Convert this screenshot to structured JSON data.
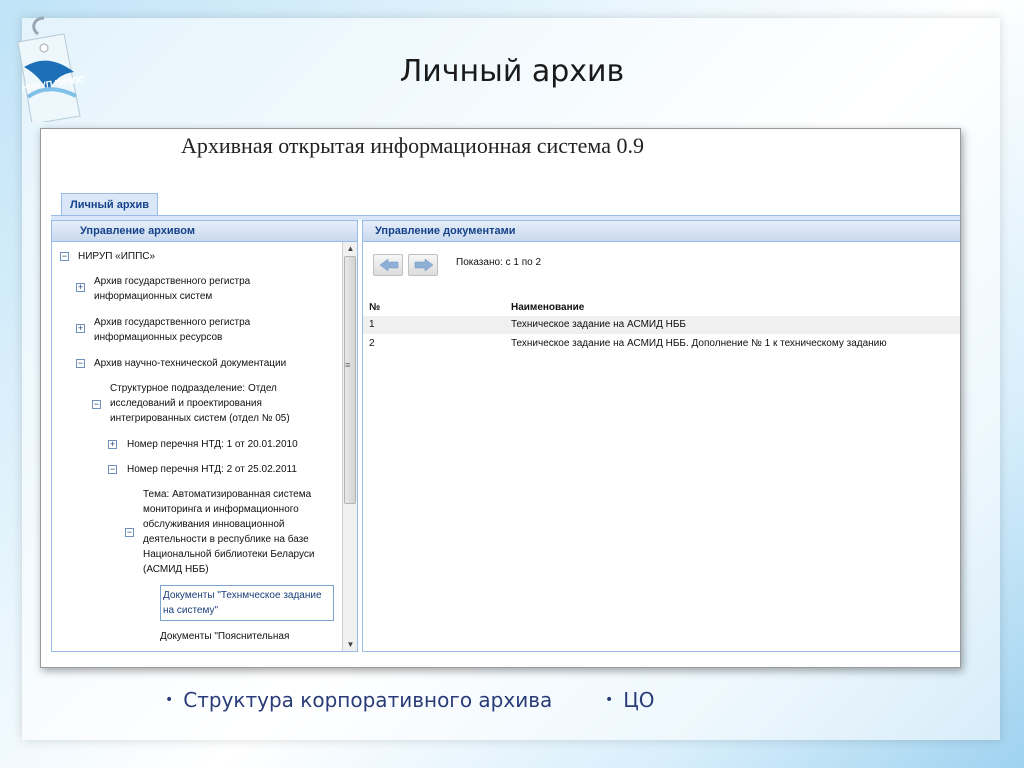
{
  "slide": {
    "title": "Личный архив",
    "logo_text": "НИРУП \"ИППС\"",
    "bullets": [
      "Структура корпоративного архива",
      "ЦО"
    ]
  },
  "app": {
    "title": "Архивная открытая информационная система 0.9",
    "tab_label": "Личный архив"
  },
  "left_panel": {
    "header": "Управление архивом",
    "tree": {
      "root": "НИРУП «ИППС»",
      "n1": "Архив государственного регистра информационных систем",
      "n2": "Архив государственного регистра информационных ресурсов",
      "n3": "Архив научно-технической документации",
      "n4": "Структурное подразделение: Отдел исследований и проектирования интегрированных систем (отдел № 05)",
      "n5": "Номер перечня НТД: 1 от 20.01.2010",
      "n6": "Номер перечня НТД: 2 от 25.02.2011",
      "n7": "Тема: Автоматизированная система мониторинга и информационного обслуживания инновационной деятельности в республике на базе Национальной библиотеки Беларуси (АСМИД НББ)",
      "n8": "Документы \"Технмческое задание на систему\"",
      "n9": "Документы \"Пояснительная"
    }
  },
  "right_panel": {
    "header": "Управление документами",
    "shown_text": "Показано: с 1 по 2",
    "columns": [
      "№",
      "Наименование"
    ],
    "rows": [
      {
        "num": "1",
        "name": "Техническое задание на АСМИД НББ"
      },
      {
        "num": "2",
        "name": "Техническое задание на АСМИД НББ. Дополнение № 1 к техническому заданию"
      }
    ]
  },
  "colors": {
    "panel_header_text": "#15428b",
    "panel_border": "#99bbe8",
    "slide_bullet_text": "#2a3c78"
  }
}
